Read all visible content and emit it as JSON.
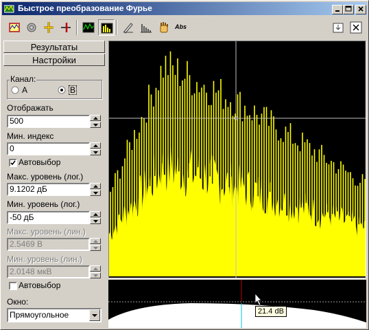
{
  "window": {
    "title": "Быстрое преобразование Фурье"
  },
  "tabs": {
    "results": "Результаты",
    "settings": "Настройки"
  },
  "channel": {
    "label": "Канал:",
    "option_a": "A",
    "option_b": "B",
    "selected": "B"
  },
  "display": {
    "label": "Отображать",
    "value": "500"
  },
  "min_index": {
    "label": "Мин. индекс",
    "value": "0"
  },
  "auto_select_1": {
    "label": "Автовыбор",
    "checked": true
  },
  "max_level_log": {
    "label": "Макс. уровень (лог.)",
    "value": "9.1202 дБ"
  },
  "min_level_log": {
    "label": "Мин. уровень (лог.)",
    "value": "-50 дБ"
  },
  "max_level_lin": {
    "label": "Макс. уровень (лин.)",
    "value": "2.5469 В"
  },
  "min_level_lin": {
    "label": "Мин. уровень (лин.)",
    "value": "2.0148 мкВ"
  },
  "auto_select_2": {
    "label": "Автовыбор",
    "checked": false
  },
  "window_fn": {
    "label": "Окно:",
    "value": "Прямоугольное"
  },
  "toolbar": {
    "abs_label": "Abs"
  },
  "tooltip": {
    "text": "21.4 dB"
  },
  "colors": {
    "spectrum": "#ffff00",
    "background": "#000000",
    "titlebar": "#0a246a",
    "cursor": "#c0c0c0"
  }
}
